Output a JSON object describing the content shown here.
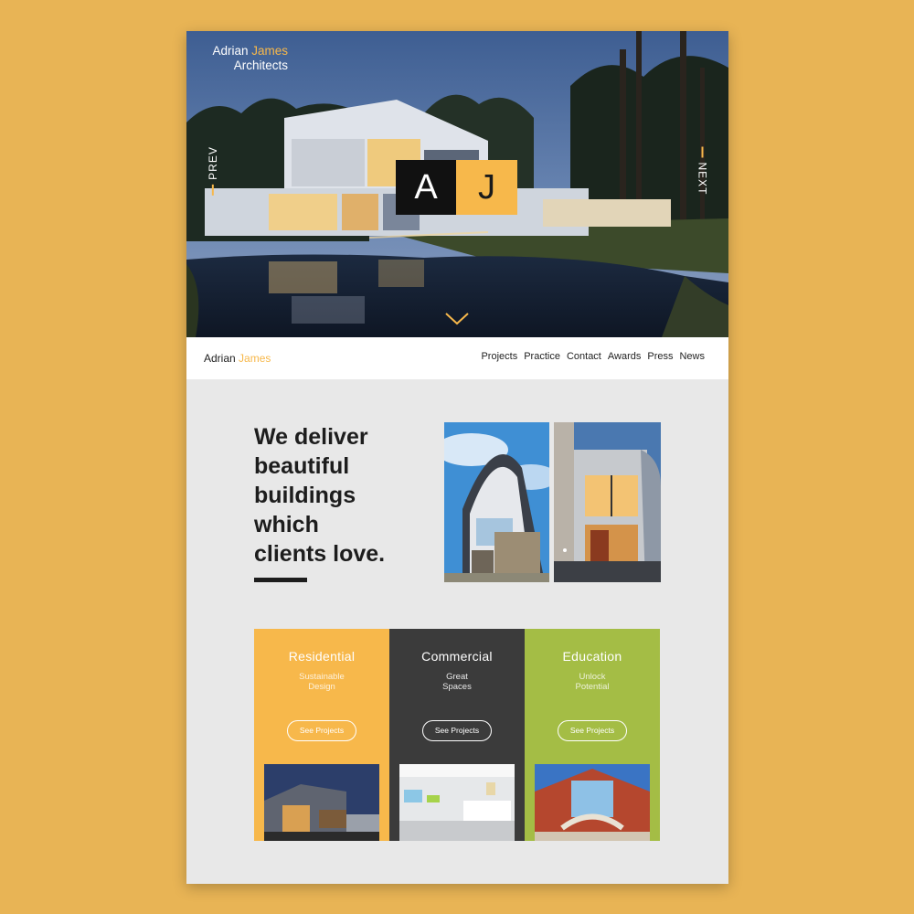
{
  "hero": {
    "brand_first": "Adrian",
    "brand_second": "James",
    "brand_line2": "Architects",
    "logo_left": "A",
    "logo_right": "J",
    "prev_label": "PREV",
    "next_label": "NEXT"
  },
  "nav": {
    "brand_first": "Adrian",
    "brand_second": "James",
    "items": [
      "Projects",
      "Practice",
      "Contact",
      "Awards",
      "Press",
      "News"
    ]
  },
  "intro": {
    "headline_lines": [
      "We deliver",
      "beautiful",
      "buildings",
      "which",
      "clients love."
    ]
  },
  "cards": [
    {
      "title": "Residential",
      "subtitle": "Sustainable Design",
      "button": "See Projects",
      "color": "#f7b84b"
    },
    {
      "title": "Commercial",
      "subtitle": "Great Spaces",
      "button": "See Projects",
      "color": "#3b3b3b"
    },
    {
      "title": "Education",
      "subtitle": "Unlock Potential",
      "button": "See Projects",
      "color": "#a4bd45"
    }
  ],
  "colors": {
    "background": "#e8b455",
    "accent": "#f7b84b",
    "dark": "#1d1d1d"
  },
  "icons": {
    "scroll": "chevron-down-icon"
  }
}
